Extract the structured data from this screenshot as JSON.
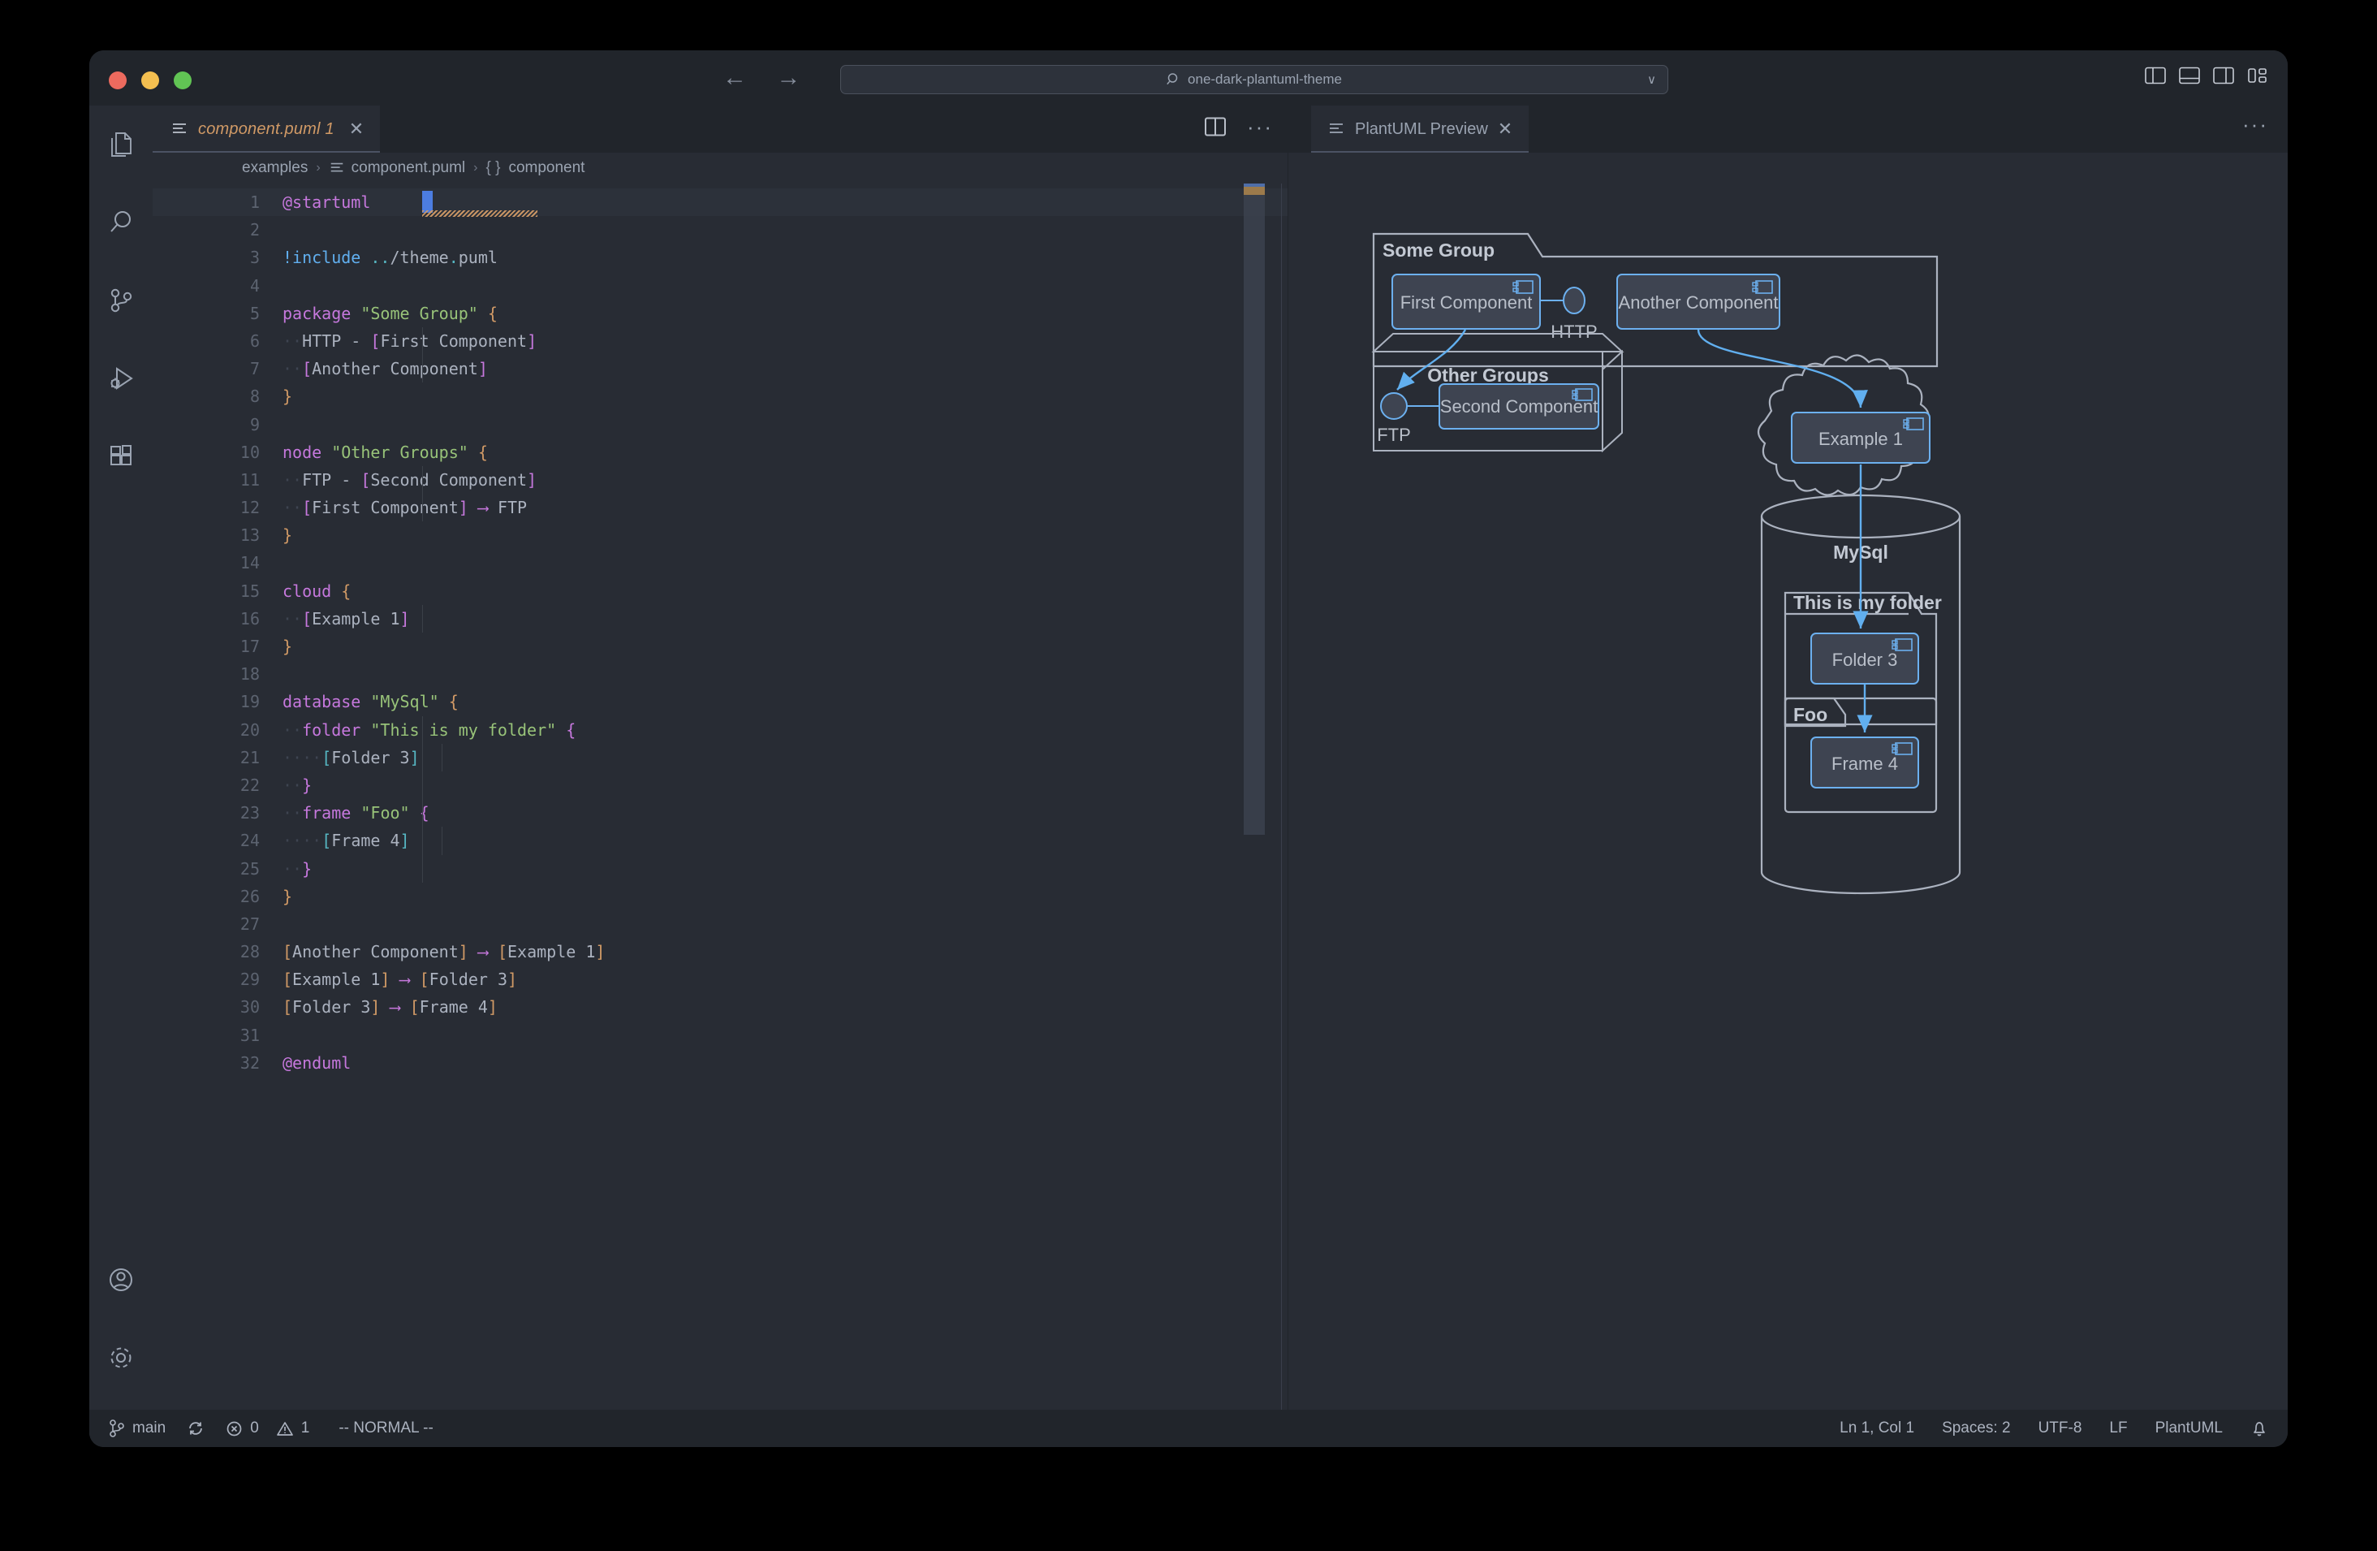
{
  "window": {
    "traffic_lights": [
      "close",
      "minimize",
      "maximize"
    ],
    "search": {
      "value": "one-dark-plantuml-theme",
      "icon": "search-icon",
      "chevron": "∨"
    },
    "nav": {
      "back": "←",
      "forward": "→"
    },
    "layout_buttons": [
      "toggle-primary-sidebar",
      "toggle-panel",
      "toggle-secondary-sidebar",
      "customize-layout"
    ]
  },
  "activity_bar": {
    "items": [
      {
        "name": "explorer",
        "icon": "files-icon"
      },
      {
        "name": "search",
        "icon": "search-icon"
      },
      {
        "name": "source-control",
        "icon": "source-control-icon"
      },
      {
        "name": "run-debug",
        "icon": "run-debug-icon"
      },
      {
        "name": "extensions",
        "icon": "extensions-icon"
      }
    ],
    "bottom_items": [
      {
        "name": "accounts",
        "icon": "account-icon"
      },
      {
        "name": "settings",
        "icon": "gear-icon"
      }
    ]
  },
  "editor": {
    "tab": {
      "label": "component.puml 1",
      "icon": "plantuml-file-icon",
      "close": "✕"
    },
    "actions": {
      "split": "split-editor-icon",
      "more": "···"
    },
    "breadcrumb": [
      "examples",
      "component.puml",
      "component"
    ],
    "breadcrumb_separator": "›",
    "symbol_prefix": "{ }",
    "lines": [
      {
        "n": 1,
        "tokens": [
          {
            "t": "@startuml",
            "c": "kw"
          }
        ],
        "current": true
      },
      {
        "n": 2,
        "tokens": []
      },
      {
        "n": 3,
        "tokens": [
          {
            "t": "!include",
            "c": "pre"
          },
          {
            "t": " ",
            "c": "punct"
          },
          {
            "t": "..",
            "c": "dot"
          },
          {
            "t": "/theme",
            "c": "pth"
          },
          {
            "t": ".",
            "c": "dot"
          },
          {
            "t": "puml",
            "c": "pth"
          }
        ]
      },
      {
        "n": 4,
        "tokens": []
      },
      {
        "n": 5,
        "tokens": [
          {
            "t": "package",
            "c": "kw"
          },
          {
            "t": " ",
            "c": "punct"
          },
          {
            "t": "\"Some Group\"",
            "c": "str"
          },
          {
            "t": " ",
            "c": "punct"
          },
          {
            "t": "{",
            "c": "br1"
          }
        ]
      },
      {
        "n": 6,
        "tokens": [
          {
            "t": "··",
            "c": "ind"
          },
          {
            "t": "HTTP",
            "c": "punct"
          },
          {
            "t": " - ",
            "c": "punct"
          },
          {
            "t": "[",
            "c": "br2"
          },
          {
            "t": "First Component",
            "c": "punct"
          },
          {
            "t": "]",
            "c": "br2"
          }
        ],
        "guide": 1
      },
      {
        "n": 7,
        "tokens": [
          {
            "t": "··",
            "c": "ind"
          },
          {
            "t": "[",
            "c": "br2"
          },
          {
            "t": "Another Component",
            "c": "punct"
          },
          {
            "t": "]",
            "c": "br2"
          }
        ],
        "guide": 1
      },
      {
        "n": 8,
        "tokens": [
          {
            "t": "}",
            "c": "br1"
          }
        ]
      },
      {
        "n": 9,
        "tokens": []
      },
      {
        "n": 10,
        "tokens": [
          {
            "t": "node",
            "c": "kw"
          },
          {
            "t": " ",
            "c": "punct"
          },
          {
            "t": "\"Other Groups\"",
            "c": "str"
          },
          {
            "t": " ",
            "c": "punct"
          },
          {
            "t": "{",
            "c": "br1"
          }
        ]
      },
      {
        "n": 11,
        "tokens": [
          {
            "t": "··",
            "c": "ind"
          },
          {
            "t": "FTP",
            "c": "punct"
          },
          {
            "t": " - ",
            "c": "punct"
          },
          {
            "t": "[",
            "c": "br2"
          },
          {
            "t": "Second Component",
            "c": "punct"
          },
          {
            "t": "]",
            "c": "br2"
          }
        ],
        "guide": 1
      },
      {
        "n": 12,
        "tokens": [
          {
            "t": "··",
            "c": "ind"
          },
          {
            "t": "[",
            "c": "br2"
          },
          {
            "t": "First Component",
            "c": "punct"
          },
          {
            "t": "]",
            "c": "br2"
          },
          {
            "t": " ",
            "c": "punct"
          },
          {
            "t": "⟶",
            "c": "arrow"
          },
          {
            "t": " FTP",
            "c": "punct"
          }
        ],
        "guide": 1
      },
      {
        "n": 13,
        "tokens": [
          {
            "t": "}",
            "c": "br1"
          }
        ]
      },
      {
        "n": 14,
        "tokens": []
      },
      {
        "n": 15,
        "tokens": [
          {
            "t": "cloud",
            "c": "kw"
          },
          {
            "t": " ",
            "c": "punct"
          },
          {
            "t": "{",
            "c": "br1"
          }
        ]
      },
      {
        "n": 16,
        "tokens": [
          {
            "t": "··",
            "c": "ind"
          },
          {
            "t": "[",
            "c": "br2"
          },
          {
            "t": "Example 1",
            "c": "punct"
          },
          {
            "t": "]",
            "c": "br2"
          }
        ],
        "guide": 1
      },
      {
        "n": 17,
        "tokens": [
          {
            "t": "}",
            "c": "br1"
          }
        ]
      },
      {
        "n": 18,
        "tokens": []
      },
      {
        "n": 19,
        "tokens": [
          {
            "t": "database",
            "c": "kw"
          },
          {
            "t": " ",
            "c": "punct"
          },
          {
            "t": "\"MySql\"",
            "c": "str"
          },
          {
            "t": " ",
            "c": "punct"
          },
          {
            "t": "{",
            "c": "br1"
          }
        ]
      },
      {
        "n": 20,
        "tokens": [
          {
            "t": "··",
            "c": "ind"
          },
          {
            "t": "folder",
            "c": "kw"
          },
          {
            "t": " ",
            "c": "punct"
          },
          {
            "t": "\"This is my folder\"",
            "c": "str"
          },
          {
            "t": " ",
            "c": "punct"
          },
          {
            "t": "{",
            "c": "br2"
          }
        ],
        "guide": 1
      },
      {
        "n": 21,
        "tokens": [
          {
            "t": "··",
            "c": "ind"
          },
          {
            "t": "··",
            "c": "ind"
          },
          {
            "t": "[",
            "c": "br3"
          },
          {
            "t": "Folder 3",
            "c": "punct"
          },
          {
            "t": "]",
            "c": "br3"
          }
        ],
        "guide": 2
      },
      {
        "n": 22,
        "tokens": [
          {
            "t": "··",
            "c": "ind"
          },
          {
            "t": "}",
            "c": "br2"
          }
        ],
        "guide": 1
      },
      {
        "n": 23,
        "tokens": [
          {
            "t": "··",
            "c": "ind"
          },
          {
            "t": "frame",
            "c": "kw"
          },
          {
            "t": " ",
            "c": "punct"
          },
          {
            "t": "\"Foo\"",
            "c": "str"
          },
          {
            "t": " ",
            "c": "punct"
          },
          {
            "t": "{",
            "c": "br2"
          }
        ],
        "guide": 1
      },
      {
        "n": 24,
        "tokens": [
          {
            "t": "··",
            "c": "ind"
          },
          {
            "t": "··",
            "c": "ind"
          },
          {
            "t": "[",
            "c": "br3"
          },
          {
            "t": "Frame 4",
            "c": "punct"
          },
          {
            "t": "]",
            "c": "br3"
          }
        ],
        "guide": 2
      },
      {
        "n": 25,
        "tokens": [
          {
            "t": "··",
            "c": "ind"
          },
          {
            "t": "}",
            "c": "br2"
          }
        ],
        "guide": 1
      },
      {
        "n": 26,
        "tokens": [
          {
            "t": "}",
            "c": "br1"
          }
        ]
      },
      {
        "n": 27,
        "tokens": []
      },
      {
        "n": 28,
        "tokens": [
          {
            "t": "[",
            "c": "br1"
          },
          {
            "t": "Another Component",
            "c": "punct"
          },
          {
            "t": "]",
            "c": "br1"
          },
          {
            "t": " ",
            "c": "punct"
          },
          {
            "t": "⟶",
            "c": "arrow"
          },
          {
            "t": " ",
            "c": "punct"
          },
          {
            "t": "[",
            "c": "br1"
          },
          {
            "t": "Example 1",
            "c": "punct"
          },
          {
            "t": "]",
            "c": "br1"
          }
        ]
      },
      {
        "n": 29,
        "tokens": [
          {
            "t": "[",
            "c": "br1"
          },
          {
            "t": "Example 1",
            "c": "punct"
          },
          {
            "t": "]",
            "c": "br1"
          },
          {
            "t": " ",
            "c": "punct"
          },
          {
            "t": "⟶",
            "c": "arrow"
          },
          {
            "t": " ",
            "c": "punct"
          },
          {
            "t": "[",
            "c": "br1"
          },
          {
            "t": "Folder 3",
            "c": "punct"
          },
          {
            "t": "]",
            "c": "br1"
          }
        ]
      },
      {
        "n": 30,
        "tokens": [
          {
            "t": "[",
            "c": "br1"
          },
          {
            "t": "Folder 3",
            "c": "punct"
          },
          {
            "t": "]",
            "c": "br1"
          },
          {
            "t": " ",
            "c": "punct"
          },
          {
            "t": "⟶",
            "c": "arrow"
          },
          {
            "t": " ",
            "c": "punct"
          },
          {
            "t": "[",
            "c": "br1"
          },
          {
            "t": "Frame 4",
            "c": "punct"
          },
          {
            "t": "]",
            "c": "br1"
          }
        ]
      },
      {
        "n": 31,
        "tokens": []
      },
      {
        "n": 32,
        "tokens": [
          {
            "t": "@enduml",
            "c": "kw"
          }
        ]
      }
    ]
  },
  "preview": {
    "tab": {
      "label": "PlantUML Preview",
      "icon": "preview-icon",
      "close": "✕"
    },
    "actions": {
      "more": "···"
    }
  },
  "diagram": {
    "packages": [
      {
        "name": "Some Group",
        "shape": "package"
      },
      {
        "name": "Other Groups",
        "shape": "node"
      },
      {
        "name": "MySql",
        "shape": "database"
      },
      {
        "name": "This is my folder",
        "shape": "folder"
      },
      {
        "name": "Foo",
        "shape": "frame"
      }
    ],
    "components": [
      {
        "label": "First Component"
      },
      {
        "label": "Another Component"
      },
      {
        "label": "Second Component"
      },
      {
        "label": "Example 1"
      },
      {
        "label": "Folder 3"
      },
      {
        "label": "Frame 4"
      }
    ],
    "interfaces": [
      {
        "label": "HTTP"
      },
      {
        "label": "FTP"
      }
    ],
    "cloud": {
      "shape": "cloud"
    },
    "colors": {
      "component_fill": "#3e4451",
      "component_border": "#61afef",
      "container_border": "#abb2bf",
      "arrow": "#61afef",
      "text": "#abb2bf"
    }
  },
  "status_bar": {
    "left": [
      {
        "name": "branch",
        "icon": "source-control-icon",
        "text": "main"
      },
      {
        "name": "sync",
        "icon": "sync-icon",
        "text": ""
      },
      {
        "name": "problems",
        "icon": "error-icon",
        "text": "0"
      },
      {
        "name": "warnings",
        "icon": "warning-icon",
        "text": "1"
      },
      {
        "name": "vim-mode",
        "icon": "",
        "text": "-- NORMAL --"
      }
    ],
    "right": [
      {
        "name": "cursor-position",
        "text": "Ln 1, Col 1"
      },
      {
        "name": "indentation",
        "text": "Spaces: 2"
      },
      {
        "name": "encoding",
        "text": "UTF-8"
      },
      {
        "name": "eol",
        "text": "LF"
      },
      {
        "name": "language-mode",
        "text": "PlantUML"
      },
      {
        "name": "notifications",
        "icon": "bell-icon",
        "text": ""
      }
    ]
  }
}
